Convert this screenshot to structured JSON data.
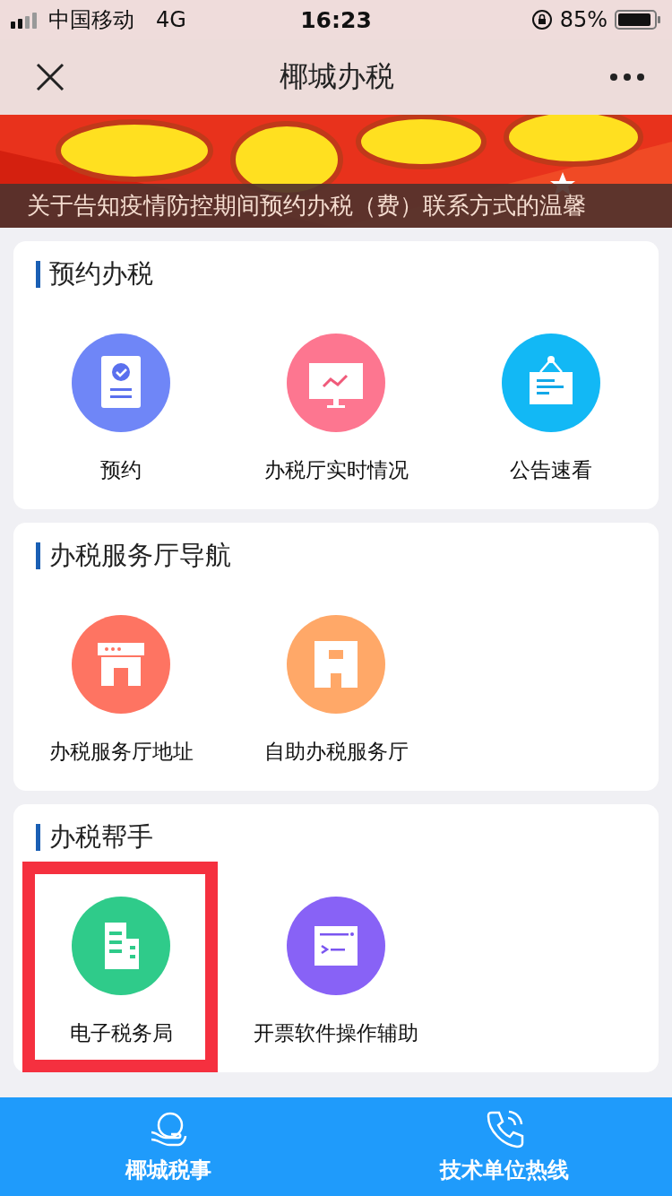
{
  "status_bar": {
    "carrier": "中国移动",
    "network": "4G",
    "time": "16:23",
    "battery": "85%"
  },
  "nav_bar": {
    "title": "椰城办税"
  },
  "banner": {
    "kind": "picture",
    "caption": "关于告知疫情防控期间预约办税（费）联系方式的温馨"
  },
  "sections": [
    {
      "title": "预约办税",
      "items": [
        {
          "label": "预约",
          "kind": "document",
          "color": "#6f86f7",
          "highlighted": false
        },
        {
          "label": "办税厅实时情况",
          "kind": "monitor",
          "color": "#fd7690",
          "highlighted": false
        },
        {
          "label": "公告速看",
          "kind": "notice",
          "color": "#12b8f5",
          "highlighted": false
        }
      ]
    },
    {
      "title": "办税服务厅导航",
      "items": [
        {
          "label": "办税服务厅地址",
          "kind": "storefront",
          "color": "#fe7462",
          "highlighted": false
        },
        {
          "label": "自助办税服务厅",
          "kind": "building",
          "color": "#ffa868",
          "highlighted": false
        }
      ]
    },
    {
      "title": "办税帮手",
      "items": [
        {
          "label": "电子税务局",
          "kind": "office",
          "color": "#2fcb8a",
          "highlighted": true
        },
        {
          "label": "开票软件操作辅助",
          "kind": "terminal",
          "color": "#8862f6",
          "highlighted": false
        }
      ]
    }
  ],
  "tab_bar": [
    {
      "label": "椰城税事",
      "kind": "hand"
    },
    {
      "label": "技术单位热线",
      "kind": "phone"
    }
  ]
}
